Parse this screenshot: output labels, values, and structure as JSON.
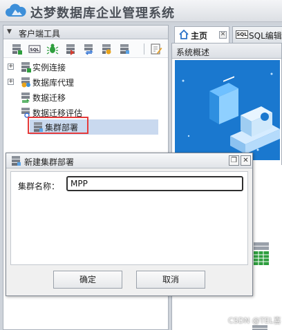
{
  "app": {
    "title": "达梦数据库企业管理系统"
  },
  "left_panel": {
    "title": "客户端工具",
    "toolbar": [
      {
        "icon": "connect-db-icon"
      },
      {
        "icon": "sql-icon"
      },
      {
        "icon": "debug-bug-icon"
      },
      {
        "icon": "migrate-icon"
      },
      {
        "icon": "transfer-icon"
      },
      {
        "icon": "monitor-icon"
      },
      {
        "icon": "db-settings-icon"
      },
      {
        "icon": "edit-icon"
      }
    ],
    "tree": [
      {
        "label": "实例连接",
        "expandable": true,
        "expander": "+"
      },
      {
        "label": "数据库代理",
        "expandable": true,
        "expander": "+"
      },
      {
        "label": "数据迁移",
        "expandable": false
      },
      {
        "label": "数据迁移评估",
        "expandable": false
      },
      {
        "label": "集群部署",
        "expandable": false,
        "selected": true
      }
    ]
  },
  "tabs": [
    {
      "label": "主页",
      "active": true,
      "icon": "home-icon",
      "close": "✕"
    },
    {
      "label": "SQL编辑",
      "active": false,
      "icon": "sql-icon",
      "badge": "SQL"
    }
  ],
  "overview": {
    "title": "系统概述"
  },
  "dialog": {
    "title": "新建集群部署",
    "field_label": "集群名称：",
    "field_value": "MPP",
    "ok_label": "确定",
    "cancel_label": "取消",
    "restore_symbol": "❐",
    "close_symbol": "✕"
  },
  "watermark": "CSDN @TEL喜",
  "colors": {
    "accent": "#1a78cf",
    "highlight_box": "#e53a3a",
    "selection": "#c9d9ef"
  }
}
